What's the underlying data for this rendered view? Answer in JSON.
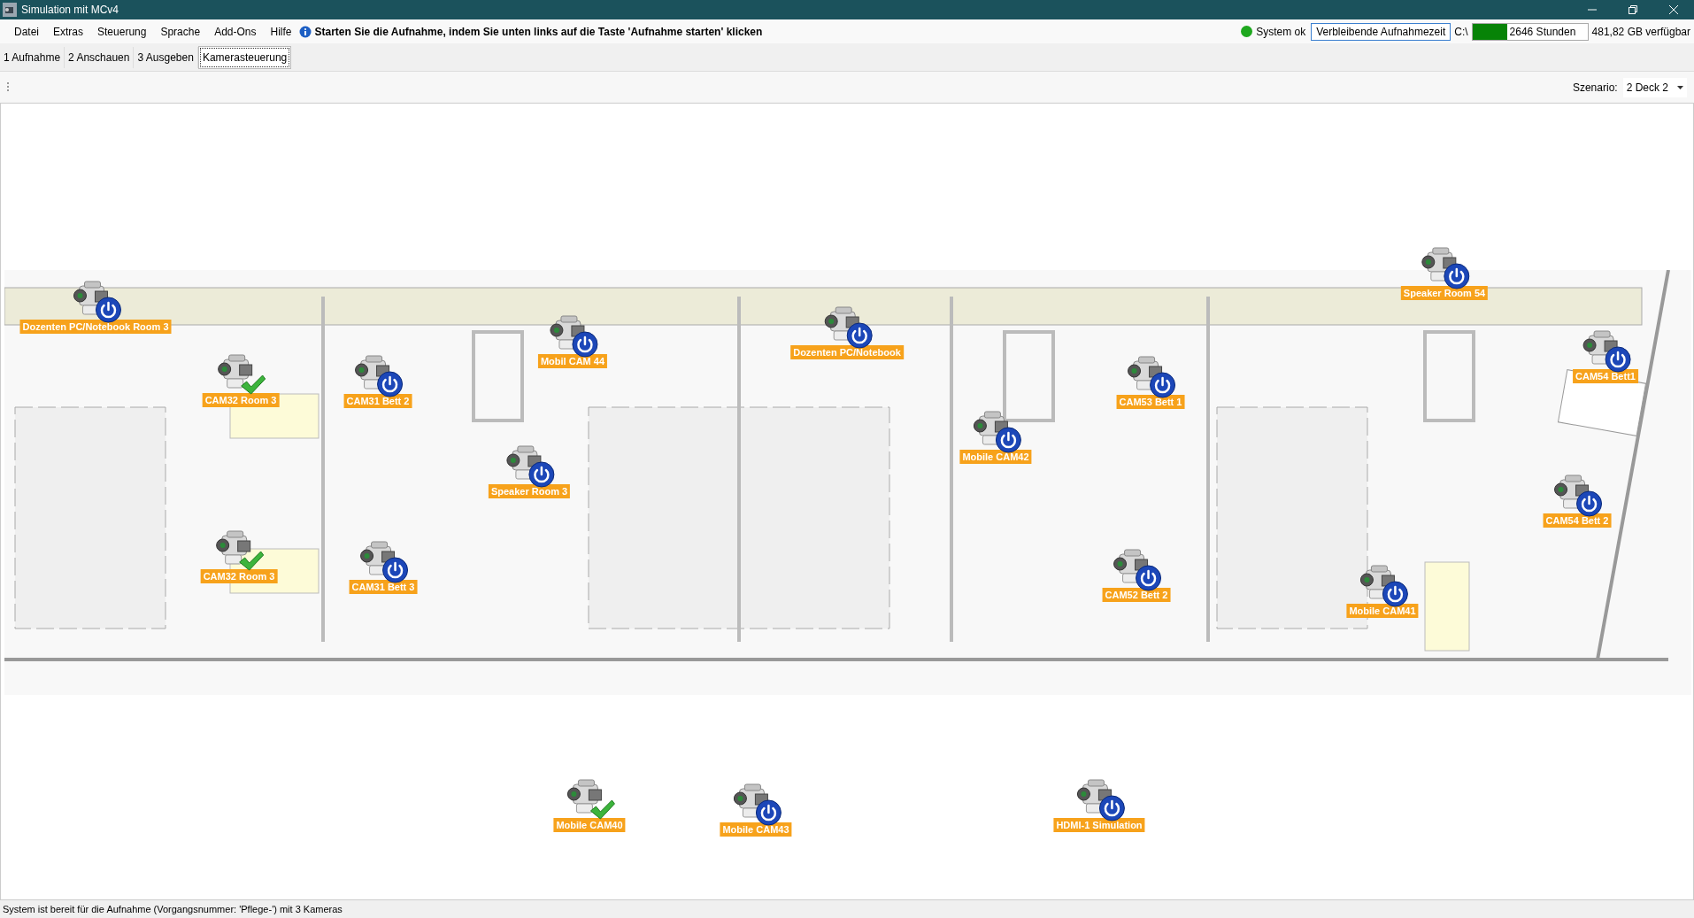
{
  "window": {
    "title": "Simulation mit MCv4"
  },
  "menu": [
    "Datei",
    "Extras",
    "Steuerung",
    "Sprache",
    "Add-Ons",
    "Hilfe"
  ],
  "info_message": "Starten Sie die Aufnahme, indem Sie unten links auf die Taste 'Aufnahme starten' klicken",
  "system_status": {
    "label": "System ok",
    "color": "#1fa81f"
  },
  "remaining_time_button": "Verbleibende Aufnahmezeit",
  "drive": {
    "label": "C:\\",
    "hours": "2646 Stunden",
    "level": 0.3,
    "free": "481,82 GB verfügbar"
  },
  "tabs": [
    {
      "label": "1 Aufnahme",
      "selected": false
    },
    {
      "label": "2 Anschauen",
      "selected": false
    },
    {
      "label": "3 Ausgeben",
      "selected": false
    },
    {
      "label": "Kamerasteuerung",
      "selected": true
    }
  ],
  "scenario": {
    "label": "Szenario:",
    "value": "2 Deck 2"
  },
  "cameras": [
    {
      "label": "Speaker Room 54",
      "ready": false
    },
    {
      "label": "Dozenten PC/Notebook Room 3",
      "ready": false
    },
    {
      "label": "Dozenten PC/Notebook",
      "ready": false
    },
    {
      "label": "Mobil CAM 44",
      "ready": false
    },
    {
      "label": "CAM54 Bett1",
      "ready": false
    },
    {
      "label": "CAM32 Room 3",
      "ready": true
    },
    {
      "label": "CAM31 Bett 2",
      "ready": false
    },
    {
      "label": "CAM53 Bett 1",
      "ready": false
    },
    {
      "label": "Mobile CAM42",
      "ready": false
    },
    {
      "label": "Speaker Room 3",
      "ready": false
    },
    {
      "label": "CAM54 Bett 2",
      "ready": false
    },
    {
      "label": "CAM32 Room 3",
      "ready": true
    },
    {
      "label": "CAM31 Bett 3",
      "ready": false
    },
    {
      "label": "CAM52 Bett 2",
      "ready": false
    },
    {
      "label": "Mobile CAM41",
      "ready": false
    },
    {
      "label": "Mobile CAM40",
      "ready": true
    },
    {
      "label": "Mobile CAM43",
      "ready": false
    },
    {
      "label": "HDMI-1 Simulation",
      "ready": false
    }
  ],
  "status_bar": "System ist bereit für die Aufnahme (Vorgangsnummer: 'Pflege-') mit 3 Kameras"
}
